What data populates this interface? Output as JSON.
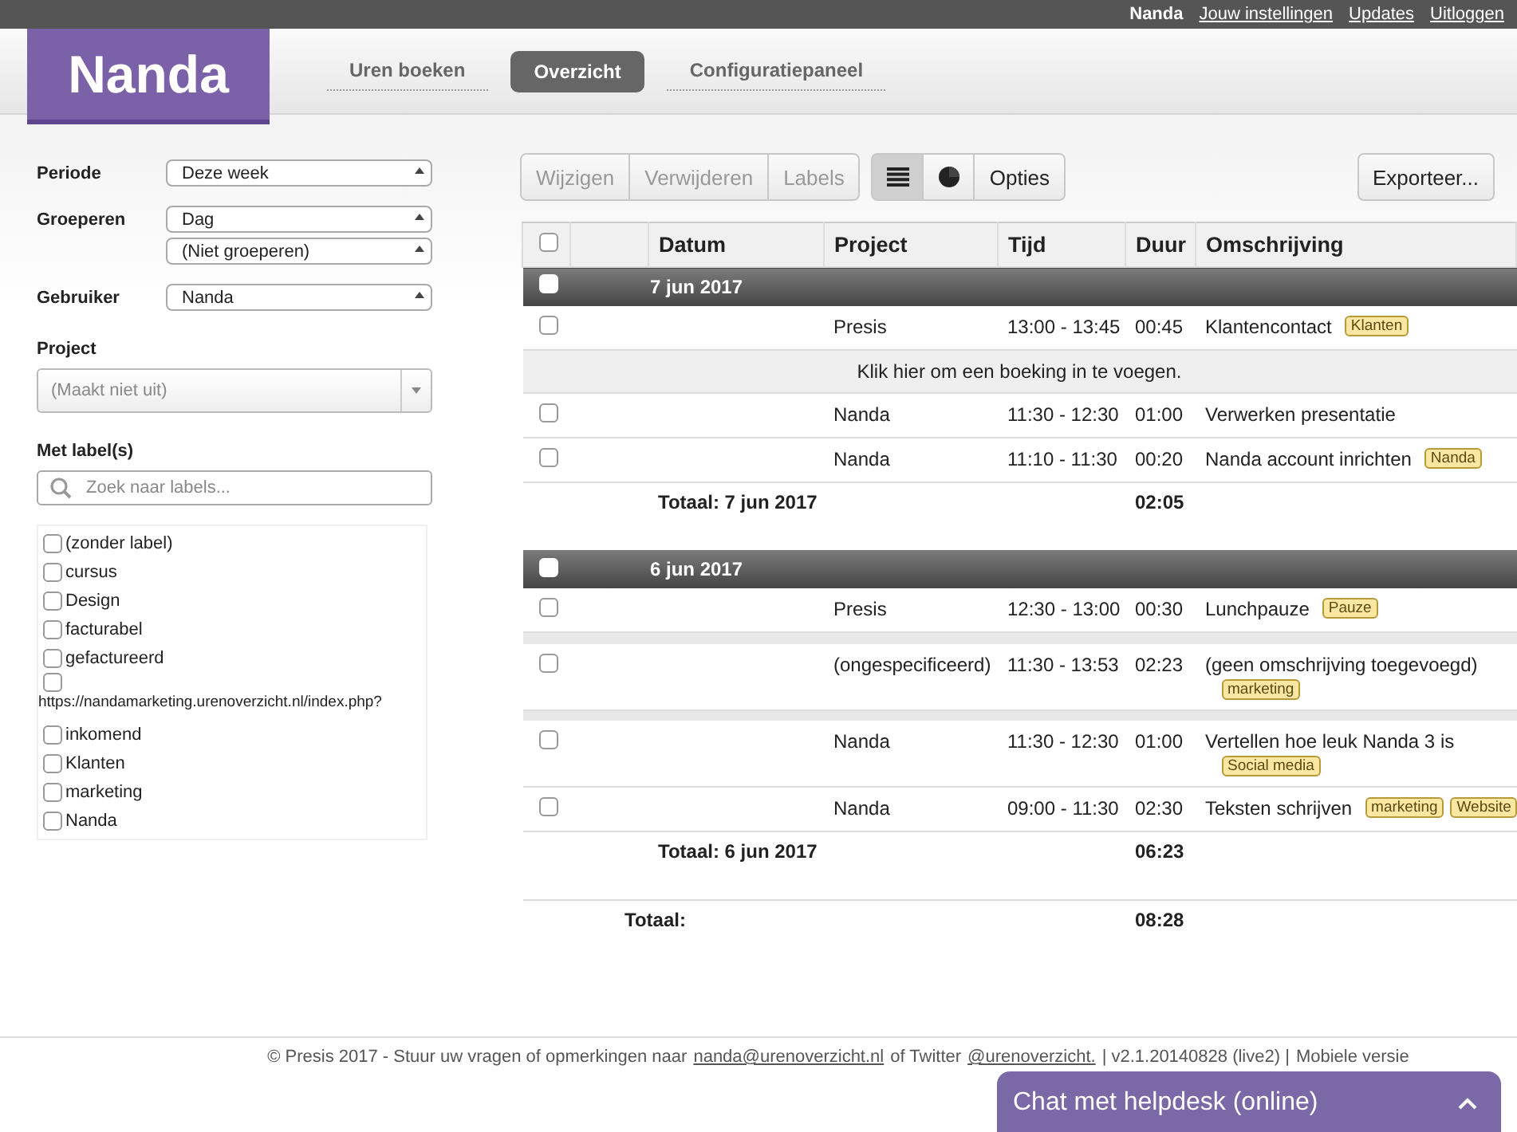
{
  "top_bar": {
    "user": "Nanda",
    "links": [
      "Jouw instellingen",
      "Updates",
      "Uitloggen"
    ]
  },
  "logo": "Nanda",
  "nav": [
    {
      "label": "Uren boeken",
      "selected": false
    },
    {
      "label": "Overzicht",
      "selected": true
    },
    {
      "label": "Configuratiepaneel",
      "selected": false
    }
  ],
  "filters": {
    "selects": [
      {
        "label": "Periode",
        "values": [
          "Deze week"
        ]
      },
      {
        "label": "Groeperen",
        "values": [
          "Dag",
          "(Niet groeperen)"
        ]
      },
      {
        "label": "Gebruiker",
        "values": [
          "Nanda"
        ]
      }
    ],
    "project": {
      "label": "Project",
      "placeholder": "(Maakt niet uit)"
    },
    "labels": {
      "label": "Met label(s)",
      "search_placeholder": "Zoek naar labels...",
      "items": [
        {
          "name": "(zonder label)",
          "checked": false
        },
        {
          "name": "cursus",
          "checked": false
        },
        {
          "name": "Design",
          "checked": false
        },
        {
          "name": "facturabel",
          "checked": false
        },
        {
          "name": "gefactureerd",
          "checked": false
        },
        {
          "name": "https://nandamarketing.urenoverzicht.nl/index.php?",
          "checked": false
        },
        {
          "name": "inkomend",
          "checked": false
        },
        {
          "name": "Klanten",
          "checked": false
        },
        {
          "name": "marketing",
          "checked": false
        },
        {
          "name": "Nanda",
          "checked": false
        }
      ]
    }
  },
  "toolbar": {
    "edit_buttons": [
      {
        "label": "Wijzigen",
        "disabled": true
      },
      {
        "label": "Verwijderen",
        "disabled": true
      },
      {
        "label": "Labels",
        "disabled": true
      }
    ],
    "view_buttons": [
      {
        "kind": "list",
        "selected": true
      },
      {
        "kind": "chart",
        "selected": false
      },
      {
        "kind": "text",
        "label": "Opties",
        "selected": false
      }
    ],
    "export": "Exporteer..."
  },
  "table": {
    "all_checked": false,
    "columns": [
      "Datum",
      "Project",
      "Tijd",
      "Duur",
      "Omschrijving"
    ],
    "groups": [
      {
        "title": "7 jun 2017",
        "checked": false,
        "rows": [
          {
            "kind": "entry",
            "checked": false,
            "project": "Presis",
            "time": "13:00 - 13:45",
            "duration": "00:45",
            "description": "Klantencontact",
            "tags": [
              "Klanten"
            ],
            "tags_inline": true
          },
          {
            "kind": "add",
            "text": "Klik hier om een boeking in te voegen."
          },
          {
            "kind": "entry",
            "checked": false,
            "project": "Nanda",
            "time": "11:30 - 12:30",
            "duration": "01:00",
            "description": "Verwerken presentatie",
            "tags": []
          },
          {
            "kind": "entry",
            "checked": false,
            "project": "Nanda",
            "time": "11:10 - 11:30",
            "duration": "00:20",
            "description": "Nanda account inrichten",
            "tags": [
              "Nanda"
            ],
            "tags_inline": true
          }
        ],
        "total_label": "Totaal: 7 jun 2017",
        "total": "02:05"
      },
      {
        "title": "6 jun 2017",
        "checked": false,
        "rows": [
          {
            "kind": "entry",
            "checked": false,
            "project": "Presis",
            "time": "12:30 - 13:00",
            "duration": "00:30",
            "description": "Lunchpauze",
            "tags": [
              "Pauze"
            ],
            "tags_inline": true
          },
          {
            "kind": "gap"
          },
          {
            "kind": "entry",
            "checked": false,
            "project": "(ongespecificeerd)",
            "time": "11:30 - 13:53",
            "duration": "02:23",
            "description": "(geen omschrijving toegevoegd)",
            "tags": [
              "marketing"
            ],
            "tags_inline": false
          },
          {
            "kind": "gap"
          },
          {
            "kind": "entry",
            "checked": false,
            "project": "Nanda",
            "time": "11:30 - 12:30",
            "duration": "01:00",
            "description": "Vertellen hoe leuk Nanda 3 is",
            "tags": [
              "Social media"
            ],
            "tags_inline": false
          },
          {
            "kind": "entry",
            "checked": false,
            "project": "Nanda",
            "time": "09:00 - 11:30",
            "duration": "02:30",
            "description": "Teksten schrijven",
            "tags": [
              "marketing",
              "Website"
            ],
            "tags_inline": true
          }
        ],
        "total_label": "Totaal: 6 jun 2017",
        "total": "06:23"
      }
    ],
    "grand_total_label": "Totaal:",
    "grand_total": "08:28"
  },
  "footer": {
    "text": "© Presis 2017 - Stuur uw vragen of opmerkingen naar",
    "email": "nanda@urenoverzicht.nl",
    "middle": "of Twitter",
    "twitter": "@urenoverzicht",
    "end": ".",
    "version": "| v2.1.20140828 (live2) |",
    "mobile": "Mobiele versie"
  },
  "chat": {
    "title": "Chat met helpdesk (online)",
    "expanded": false
  }
}
